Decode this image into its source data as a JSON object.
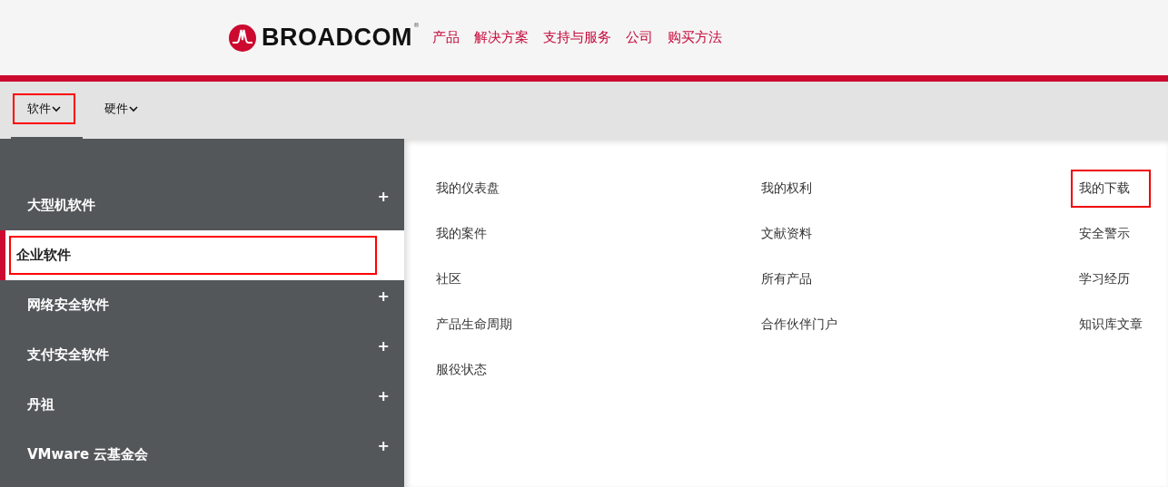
{
  "header": {
    "brand": "BROADCOM",
    "trademark": "®",
    "nav": [
      "产品",
      "解决方案",
      "支持与服务",
      "公司",
      "购买方法"
    ]
  },
  "subnav": [
    {
      "label": "软件",
      "selected": true,
      "highlighted": true
    },
    {
      "label": "硬件",
      "selected": false,
      "highlighted": false
    }
  ],
  "sidebar": {
    "items": [
      {
        "label": "大型机软件",
        "selected": false,
        "highlighted": false,
        "expandable": true
      },
      {
        "label": "企业软件",
        "selected": true,
        "highlighted": true,
        "expandable": false
      },
      {
        "label": "网络安全软件",
        "selected": false,
        "highlighted": false,
        "expandable": true
      },
      {
        "label": "支付安全软件",
        "selected": false,
        "highlighted": false,
        "expandable": true
      },
      {
        "label": "丹祖",
        "selected": false,
        "highlighted": false,
        "expandable": true
      },
      {
        "label": "VMware 云基金会",
        "selected": false,
        "highlighted": false,
        "expandable": true
      }
    ],
    "expand_glyph": "+"
  },
  "links": [
    [
      {
        "label": "我的仪表盘",
        "highlighted": false
      },
      {
        "label": "我的案件",
        "highlighted": false
      },
      {
        "label": "社区",
        "highlighted": false
      },
      {
        "label": "产品生命周期",
        "highlighted": false
      },
      {
        "label": "服役状态",
        "highlighted": false
      }
    ],
    [
      {
        "label": "我的权利",
        "highlighted": false
      },
      {
        "label": "文献资料",
        "highlighted": false
      },
      {
        "label": "所有产品",
        "highlighted": false
      },
      {
        "label": "合作伙伴门户",
        "highlighted": false
      }
    ],
    [
      {
        "label": "我的下载",
        "highlighted": true
      },
      {
        "label": "安全警示",
        "highlighted": false
      },
      {
        "label": "学习经历",
        "highlighted": false
      },
      {
        "label": "知识库文章",
        "highlighted": false
      }
    ]
  ]
}
